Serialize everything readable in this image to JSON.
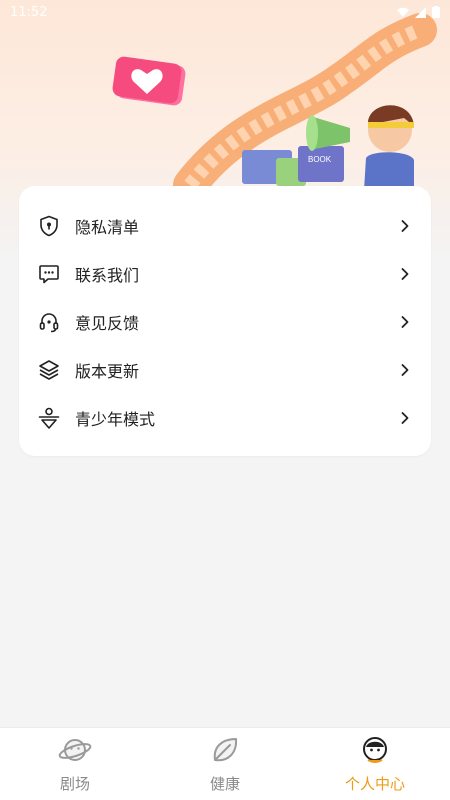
{
  "status_bar": {
    "time": "11:52"
  },
  "menu": {
    "items": [
      {
        "label": "隐私清单",
        "icon": "shield-lock-icon"
      },
      {
        "label": "联系我们",
        "icon": "chat-icon"
      },
      {
        "label": "意见反馈",
        "icon": "headset-icon"
      },
      {
        "label": "版本更新",
        "icon": "layers-icon"
      },
      {
        "label": "青少年模式",
        "icon": "youth-mode-icon"
      }
    ]
  },
  "tabbar": {
    "tabs": [
      {
        "label": "剧场",
        "icon": "planet-icon",
        "active": false
      },
      {
        "label": "健康",
        "icon": "leaf-icon",
        "active": false
      },
      {
        "label": "个人中心",
        "icon": "avatar-icon",
        "active": true
      }
    ]
  },
  "hero": {
    "book_text": "BOOK"
  },
  "colors": {
    "accent": "#f09a17",
    "tab_inactive": "#8a8a8a",
    "text": "#222222"
  }
}
